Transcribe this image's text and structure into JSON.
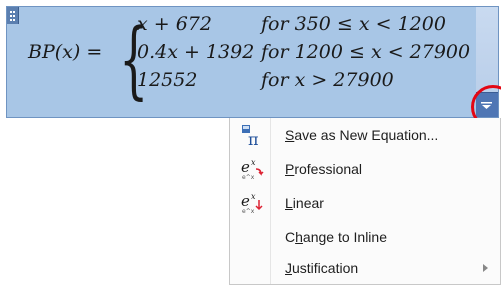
{
  "equation": {
    "lhs": "BP(x) =",
    "rows": [
      {
        "expr": "x + 672",
        "cond": "for 350 ≤ x < 1200"
      },
      {
        "expr": "0.4x + 1392",
        "cond": "for 1200 ≤ x < 27900"
      },
      {
        "expr": "12552",
        "cond": "for x > 27900"
      }
    ]
  },
  "menu": {
    "items": [
      {
        "pre": "",
        "mn": "S",
        "post": "ave as New Equation...",
        "icon": "pi-equation-icon",
        "submenu": false
      },
      {
        "pre": "",
        "mn": "P",
        "post": "rofessional",
        "icon": "professional-format-icon",
        "submenu": false
      },
      {
        "pre": "",
        "mn": "L",
        "post": "inear",
        "icon": "linear-format-icon",
        "submenu": false
      },
      {
        "pre": "C",
        "mn": "h",
        "post": "ange to Inline",
        "icon": "",
        "submenu": false
      },
      {
        "pre": "",
        "mn": "J",
        "post": "ustification",
        "icon": "",
        "submenu": true
      }
    ]
  },
  "colors": {
    "selection": "#a8c6e6",
    "highlight_ring": "#e30613",
    "dropdown_button": "#4f76b4"
  }
}
